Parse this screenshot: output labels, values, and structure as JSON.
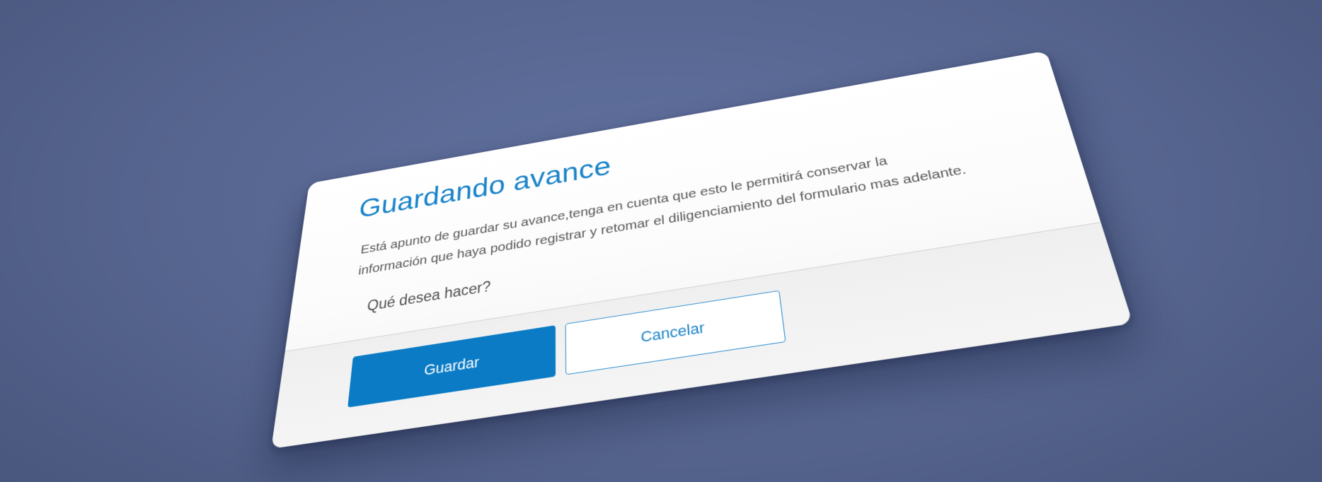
{
  "dialog": {
    "title": "Guardando avance",
    "message": "Está apunto de guardar su avance,tenga en cuenta que esto le permitirá conservar la información que haya podido registrar y retomar el diligenciamiento del formulario mas adelante.",
    "question": "Qué desea hacer?",
    "buttons": {
      "save_label": "Guardar",
      "cancel_label": "Cancelar"
    }
  },
  "colors": {
    "accent": "#0a7bc4",
    "title": "#1a83c9",
    "background": "#5d6d9a"
  }
}
